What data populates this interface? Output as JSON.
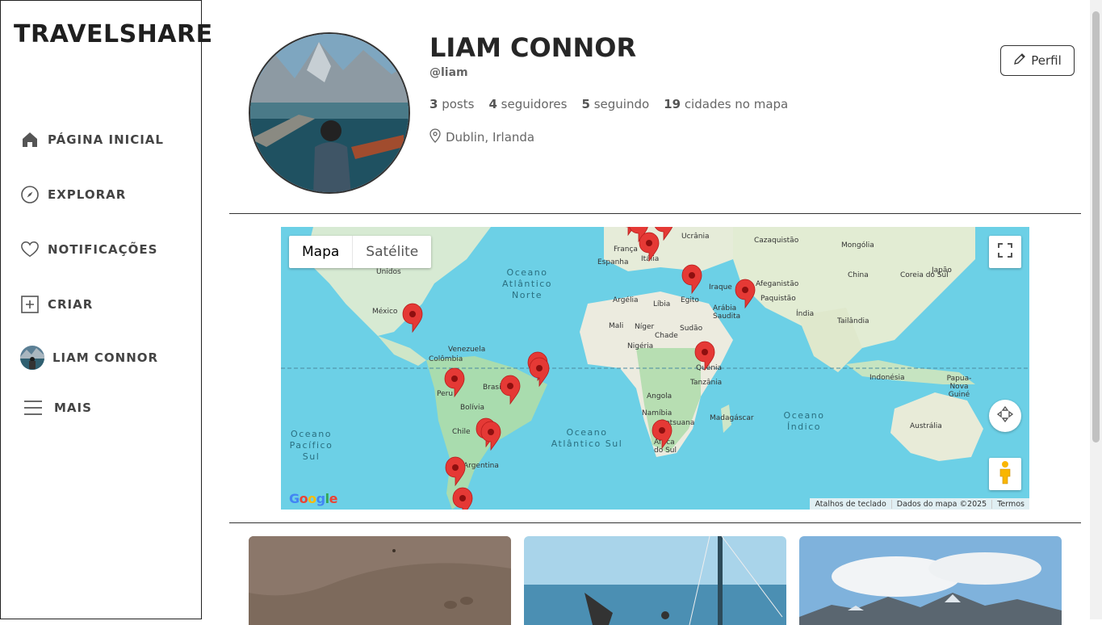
{
  "app": {
    "brand": "TRAVELSHARE"
  },
  "nav": {
    "home": "PÁGINA INICIAL",
    "explore": "EXPLORAR",
    "notifications": "NOTIFICAÇÕES",
    "create": "CRIAR",
    "profile": "LIAM CONNOR",
    "more": "MAIS"
  },
  "profile": {
    "name": "LIAM CONNOR",
    "handle": "@liam",
    "posts_count": "3",
    "posts_label": "posts",
    "followers_count": "4",
    "followers_label": "seguidores",
    "following_count": "5",
    "following_label": "seguindo",
    "cities_count": "19",
    "cities_label": "cidades no mapa",
    "location": "Dublin, Irlanda",
    "edit_label": "Perfil"
  },
  "map": {
    "tab_map": "Mapa",
    "tab_satellite": "Satélite",
    "labels": [
      "Unidos",
      "México",
      "Venezuela",
      "Colômbia",
      "Peru",
      "Brasil",
      "Bolívia",
      "Chile",
      "Argentina",
      "França",
      "Espanha",
      "Itália",
      "Ucrânia",
      "Cazaquistão",
      "Mongólia",
      "China",
      "Coreia do Sul",
      "Japão",
      "Afeganistão",
      "Paquistão",
      "Iraque",
      "Arábia Saudita",
      "Índia",
      "Tailândia",
      "Argélia",
      "Líbia",
      "Egito",
      "Mali",
      "Níger",
      "Chade",
      "Sudão",
      "Nigéria",
      "Quênia",
      "Tanzânia",
      "Angola",
      "Namíbia",
      "Botsuana",
      "Madagáscar",
      "África do Sul",
      "Indonésia",
      "Papua-Nova Guiné",
      "Austrália"
    ],
    "oceans": [
      "Oceano Atlântico Norte",
      "Oceano Pacífico Sul",
      "Oceano Atlântico Sul",
      "Oceano Índico"
    ],
    "attribution": [
      "Atalhos de teclado",
      "Dados do mapa ©2025",
      "Termos"
    ],
    "logo": "Google"
  },
  "colors": {
    "accent": "#262626",
    "pin": "#e53935",
    "water": "#6cd0e6",
    "land": "#cfe9d0"
  },
  "icons": {
    "home": "home-icon",
    "explore": "compass-icon",
    "notifications": "heart-icon",
    "create": "plus-square-icon",
    "more": "menu-icon",
    "edit": "pencil-icon",
    "location": "map-pin-icon"
  }
}
